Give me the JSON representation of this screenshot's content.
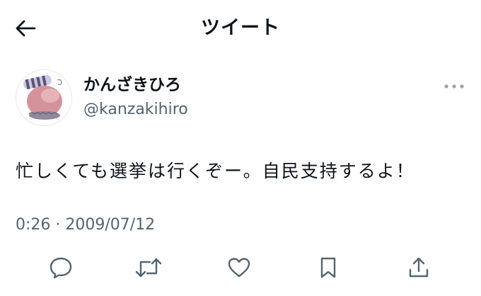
{
  "header": {
    "title": "ツイート",
    "back_icon": "arrow-left-icon"
  },
  "tweet": {
    "author": {
      "display_name": "かんざきひろ",
      "handle": "@kanzakihiro",
      "avatar_icon": "avatar-illustration"
    },
    "more_icon": "more-horizontal-icon",
    "text": "忙しくても選挙は行くぞー。自民支持するよ！",
    "timestamp": "0:26 · 2009/07/12",
    "actions": [
      {
        "name": "reply",
        "icon": "comment-icon"
      },
      {
        "name": "retweet",
        "icon": "retweet-icon"
      },
      {
        "name": "like",
        "icon": "heart-icon"
      },
      {
        "name": "bookmark",
        "icon": "bookmark-icon"
      },
      {
        "name": "share",
        "icon": "share-icon"
      }
    ]
  },
  "colors": {
    "text_primary": "#0f1419",
    "text_secondary": "#536471",
    "icon": "#536471",
    "background": "#ffffff"
  }
}
